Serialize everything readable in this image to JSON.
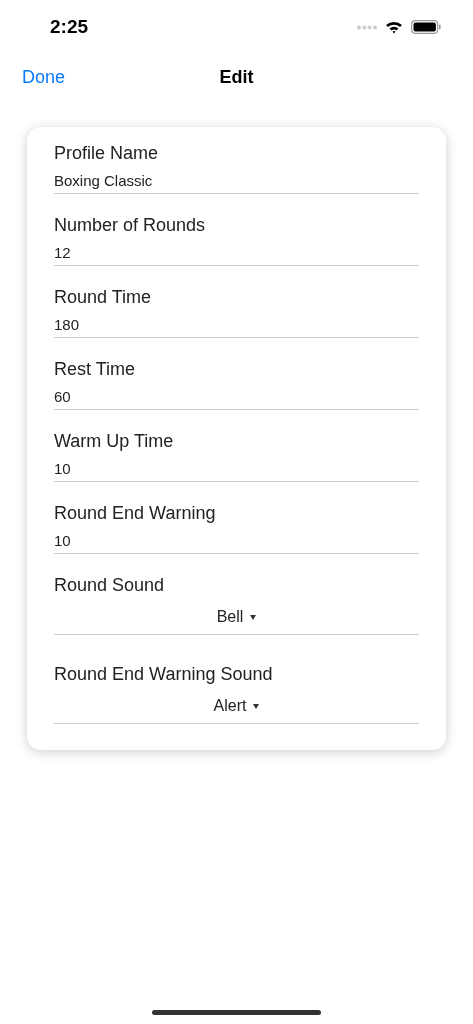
{
  "status_bar": {
    "time": "2:25"
  },
  "nav": {
    "back": "Done",
    "title": "Edit"
  },
  "fields": [
    {
      "kind": "text",
      "label": "Profile Name",
      "value": "Boxing Classic"
    },
    {
      "kind": "text",
      "label": "Number of Rounds",
      "value": "12"
    },
    {
      "kind": "text",
      "label": "Round Time",
      "value": "180"
    },
    {
      "kind": "text",
      "label": "Rest Time",
      "value": "60"
    },
    {
      "kind": "text",
      "label": "Warm Up Time",
      "value": "10"
    },
    {
      "kind": "text",
      "label": "Round End Warning",
      "value": "10"
    },
    {
      "kind": "picker",
      "label": "Round Sound",
      "value": "Bell"
    },
    {
      "kind": "picker",
      "label": "Round End Warning Sound",
      "value": "Alert"
    }
  ]
}
